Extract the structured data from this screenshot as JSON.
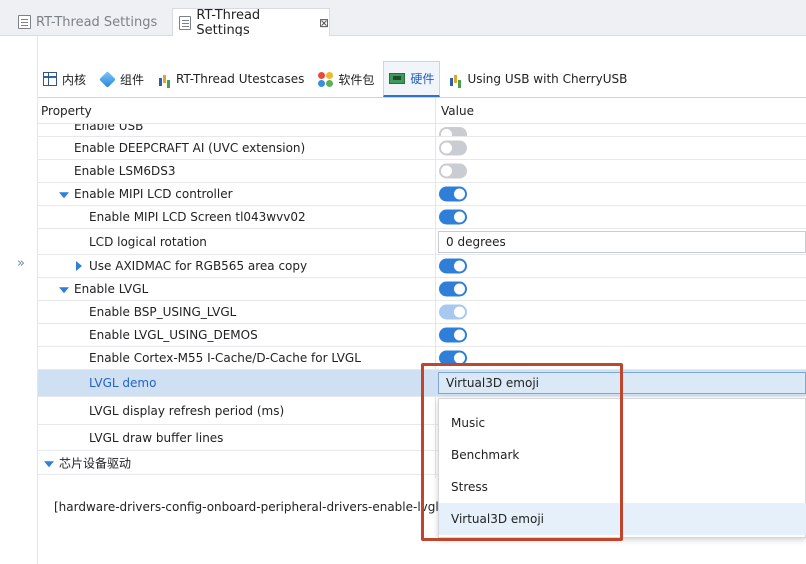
{
  "editor_tabs": [
    {
      "label": "RT-Thread Settings",
      "active": false
    },
    {
      "label": "RT-Thread Settings",
      "active": true
    }
  ],
  "close_glyph": "⊠",
  "category_tabs": [
    {
      "label": "内核",
      "icon": "grid-icon"
    },
    {
      "label": "组件",
      "icon": "cube-icon"
    },
    {
      "label": "RT-Thread Utestcases",
      "icon": "bars-icon"
    },
    {
      "label": "软件包",
      "icon": "flower-icon"
    },
    {
      "label": "硬件",
      "icon": "board-icon",
      "selected": true
    },
    {
      "label": "Using USB with CherryUSB",
      "icon": "bars-icon"
    }
  ],
  "table": {
    "header_property": "Property",
    "header_value": "Value",
    "rows": [
      {
        "label": "Enable USB",
        "value": "off"
      },
      {
        "label": "Enable DEEPCRAFT AI (UVC extension)",
        "value": "off"
      },
      {
        "label": "Enable LSM6DS3",
        "value": "off"
      },
      {
        "label": "Enable MIPI LCD controller",
        "value": "on",
        "expander": "expanded"
      },
      {
        "label": "Enable MIPI LCD Screen tl043wvv02",
        "value": "on"
      },
      {
        "label": "LCD logical rotation",
        "value": "0 degrees"
      },
      {
        "label": "Use AXIDMAC for RGB565 area copy",
        "value": "on",
        "expander": "collapsed"
      },
      {
        "label": "Enable LVGL",
        "value": "on",
        "expander": "expanded"
      },
      {
        "label": "Enable BSP_USING_LVGL",
        "value": "on (disabled)"
      },
      {
        "label": "Enable LVGL_USING_DEMOS",
        "value": "on"
      },
      {
        "label": "Enable Cortex-M55 I-Cache/D-Cache for LVGL",
        "value": "on"
      },
      {
        "label": "LVGL demo",
        "value": "Virtual3D emoji",
        "selected": true
      },
      {
        "label": "LVGL display refresh period (ms)",
        "value": ""
      },
      {
        "label": "LVGL draw buffer lines",
        "value": ""
      },
      {
        "label": "芯片设备驱动",
        "value": "",
        "expander": "expanded"
      }
    ]
  },
  "config_path": "[hardware-drivers-config-onboard-peripheral-drivers-enable-lvgl-lv",
  "dropdown": {
    "options": [
      "Music",
      "Benchmark",
      "Stress",
      "Virtual3D emoji"
    ],
    "selected": "Virtual3D emoji"
  },
  "colors": {
    "accent": "#2f7fd9",
    "selection_row": "#cfe0f3",
    "annotation_box": "#c0452c"
  }
}
